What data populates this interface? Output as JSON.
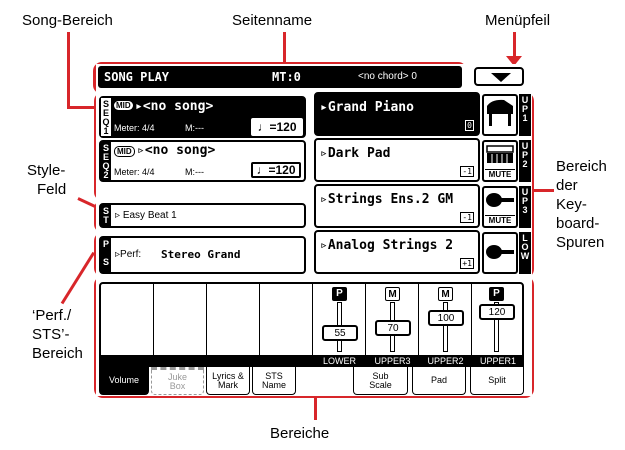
{
  "callouts": {
    "song_area": "Song-Bereich",
    "page_name": "Seitenname",
    "menu_arrow": "Menüpfeil",
    "style_field": [
      "Style-",
      "Feld"
    ],
    "keyboard_tracks": [
      "Bereich",
      "der",
      "Key-",
      "board-",
      "Spuren"
    ],
    "perf_sts": [
      "‘Perf./",
      "STS’-",
      "Bereich"
    ],
    "areas": "Bereiche"
  },
  "header": {
    "title": "SONG PLAY",
    "mt": "MT:0",
    "chord": "<no chord> 0"
  },
  "sequencers": [
    {
      "label": "SEQ1",
      "midi": "MID",
      "song": "<no song>",
      "meter": "Meter: 4/4",
      "measure": "M:---",
      "tempo": "♩=120"
    },
    {
      "label": "SEQ2",
      "midi": "MID",
      "song": "<no song>",
      "meter": "Meter: 4/4",
      "measure": "M:---",
      "tempo": "♩=120"
    }
  ],
  "style": {
    "label": "ST",
    "name": "Easy Beat 1"
  },
  "perf": {
    "label": "PS",
    "prefix": "Perf:",
    "name": "Stereo Grand"
  },
  "tracks": [
    {
      "name": "Grand Piano",
      "sub": "0",
      "side": "UP1",
      "mute": "",
      "selected": true
    },
    {
      "name": "Dark Pad",
      "sub": "-1",
      "side": "UP2",
      "mute": "MUTE",
      "selected": false
    },
    {
      "name": "Strings Ens.2 GM",
      "sub": "-1",
      "side": "UP3",
      "mute": "MUTE",
      "selected": false
    },
    {
      "name": "Analog Strings 2",
      "sub": "+1",
      "side": "LOW",
      "mute": "",
      "selected": false
    }
  ],
  "mixer": [
    {
      "mode": "P",
      "value": "55",
      "name": "LOWER",
      "level": 0.43
    },
    {
      "mode": "M",
      "value": "70",
      "name": "UPPER3",
      "level": 0.55
    },
    {
      "mode": "M",
      "value": "100",
      "name": "UPPER2",
      "level": 0.79
    },
    {
      "mode": "P",
      "value": "120",
      "name": "UPPER1",
      "level": 0.94
    }
  ],
  "tabs": [
    "Volume",
    "Juke Box",
    "Lyrics & Mark",
    "STS Name",
    "",
    "Sub Scale",
    "Pad",
    "Split"
  ],
  "colors": {
    "callout_red": "#d8262a",
    "screen_black": "#000000"
  }
}
